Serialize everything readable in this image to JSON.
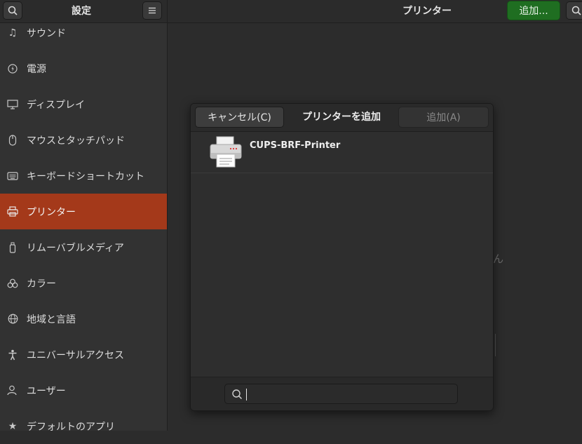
{
  "sidebar": {
    "title": "設定",
    "items": [
      {
        "label": "サウンド",
        "icon": "music-note-icon"
      },
      {
        "label": "電源",
        "icon": "power-icon"
      },
      {
        "label": "ディスプレイ",
        "icon": "display-icon"
      },
      {
        "label": "マウスとタッチパッド",
        "icon": "mouse-icon"
      },
      {
        "label": "キーボードショートカット",
        "icon": "keyboard-icon"
      },
      {
        "label": "プリンター",
        "icon": "printer-icon",
        "selected": true
      },
      {
        "label": "リムーバブルメディア",
        "icon": "usb-drive-icon"
      },
      {
        "label": "カラー",
        "icon": "color-icon"
      },
      {
        "label": "地域と言語",
        "icon": "globe-icon"
      },
      {
        "label": "ユニバーサルアクセス",
        "icon": "accessibility-icon"
      },
      {
        "label": "ユーザー",
        "icon": "user-icon"
      },
      {
        "label": "デフォルトのアプリ",
        "icon": "star-icon"
      }
    ]
  },
  "main": {
    "title": "プリンター",
    "add_label": "追加...",
    "background_text": "ん"
  },
  "dialog": {
    "cancel_label": "キャンセル(C)",
    "title": "プリンターを追加",
    "add_label": "追加(A)",
    "printers": [
      {
        "name": "CUPS-BRF-Printer"
      }
    ],
    "search_value": ""
  },
  "colors": {
    "selected_item": "#a4391a",
    "add_button": "#1f6e21"
  }
}
